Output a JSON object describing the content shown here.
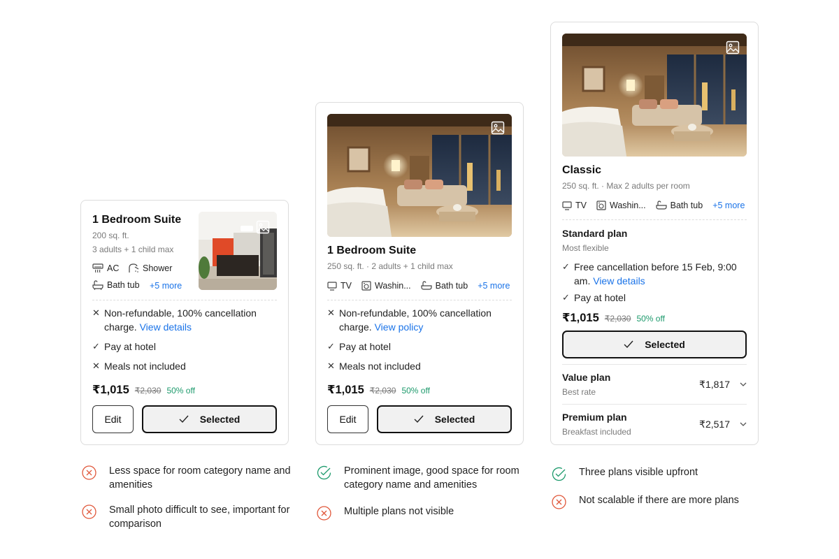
{
  "card1": {
    "title": "1 Bedroom Suite",
    "size": "200 sq. ft.",
    "occupancy": "3 adults + 1 child max",
    "amenities": [
      "AC",
      "Shower",
      "Bath tub"
    ],
    "more": "+5 more",
    "policy_text": "Non-refundable, 100% cancellation charge.",
    "policy_link": "View details",
    "pay": "Pay at hotel",
    "meals": "Meals not included",
    "price": "₹1,015",
    "original_price": "₹2,030",
    "discount": "50% off",
    "edit_label": "Edit",
    "selected_label": "Selected"
  },
  "card2": {
    "title": "1 Bedroom Suite",
    "details": "250 sq. ft. · 2 adults + 1 child max",
    "amenities": [
      "TV",
      "Washin...",
      "Bath tub"
    ],
    "more": "+5 more",
    "policy_text": "Non-refundable, 100% cancellation charge.",
    "policy_link": "View policy",
    "pay": "Pay at hotel",
    "meals": "Meals not included",
    "price": "₹1,015",
    "original_price": "₹2,030",
    "discount": "50% off",
    "edit_label": "Edit",
    "selected_label": "Selected"
  },
  "card3": {
    "title": "Classic",
    "details": "250 sq. ft. · Max 2 adults per room",
    "amenities": [
      "TV",
      "Washin...",
      "Bath tub"
    ],
    "more": "+5 more",
    "standard_plan": {
      "name": "Standard plan",
      "subtitle": "Most flexible",
      "cancellation": "Free cancellation before 15 Feb, 9:00 am.",
      "cancellation_link": "View details",
      "pay": "Pay at hotel",
      "price": "₹1,015",
      "original_price": "₹2,030",
      "discount": "50% off",
      "selected_label": "Selected"
    },
    "value_plan": {
      "name": "Value plan",
      "subtitle": "Best rate",
      "price": "₹1,817"
    },
    "premium_plan": {
      "name": "Premium plan",
      "subtitle": "Breakfast included",
      "price": "₹2,517"
    }
  },
  "notes": {
    "col1": [
      {
        "type": "con",
        "text": "Less space for room category name and amenities"
      },
      {
        "type": "con",
        "text": "Small photo difficult to see, important for comparison"
      }
    ],
    "col2": [
      {
        "type": "pro",
        "text": "Prominent image, good space for room category name and amenities"
      },
      {
        "type": "con",
        "text": "Multiple plans not visible"
      }
    ],
    "col3": [
      {
        "type": "pro",
        "text": "Three plans visible upfront"
      },
      {
        "type": "con",
        "text": "Not scalable if there are more plans"
      }
    ]
  },
  "colors": {
    "link": "#1a73e8",
    "discount": "#1d9a6c",
    "pro": "#1d9a6c",
    "con": "#e0573a"
  }
}
